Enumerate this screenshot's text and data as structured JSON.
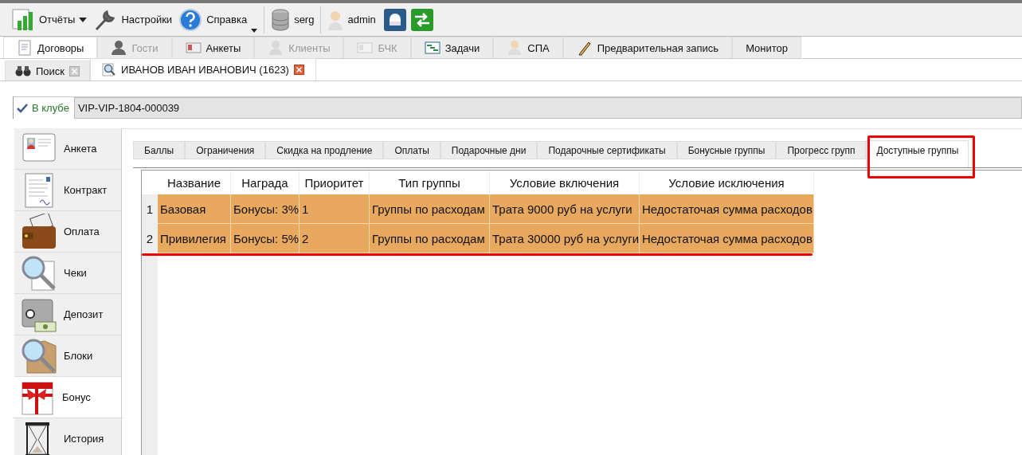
{
  "toolbar": {
    "items": [
      {
        "label": "Отчёты",
        "kind": "dropdown"
      },
      {
        "label": "Настройки",
        "kind": "button"
      },
      {
        "label": "Справка",
        "kind": "menu"
      },
      {
        "label": "serg",
        "kind": "database"
      },
      {
        "label": "admin",
        "kind": "user"
      }
    ]
  },
  "module_tabs": [
    {
      "label": "Договоры",
      "selected": true,
      "disabled": false
    },
    {
      "label": "Гости",
      "selected": false,
      "disabled": true
    },
    {
      "label": "Анкеты",
      "selected": false,
      "disabled": false
    },
    {
      "label": "Клиенты",
      "selected": false,
      "disabled": true
    },
    {
      "label": "БЧК",
      "selected": false,
      "disabled": true
    },
    {
      "label": "Задачи",
      "selected": false,
      "disabled": false
    },
    {
      "label": "СПА",
      "selected": false,
      "disabled": false
    },
    {
      "label": "Предварительная запись",
      "selected": false,
      "disabled": false
    },
    {
      "label": "Монитор",
      "selected": false,
      "disabled": false
    }
  ],
  "doc_tabs": [
    {
      "label": "Поиск",
      "selected": false
    },
    {
      "label": "ИВАНОВ ИВАН ИВАНОВИЧ (1623)",
      "selected": true
    }
  ],
  "club": {
    "label": "В клубе",
    "value": "VIP-VIP-1804-000039"
  },
  "sidebar": {
    "items": [
      {
        "label": "Анкета",
        "selected": false
      },
      {
        "label": "Контракт",
        "selected": false
      },
      {
        "label": "Оплата",
        "selected": false
      },
      {
        "label": "Чеки",
        "selected": false
      },
      {
        "label": "Депозит",
        "selected": false
      },
      {
        "label": "Блоки",
        "selected": false
      },
      {
        "label": "Бонус",
        "selected": true
      },
      {
        "label": "История",
        "selected": false
      }
    ]
  },
  "inner_tabs": [
    {
      "label": "Баллы",
      "selected": false
    },
    {
      "label": "Ограничения",
      "selected": false
    },
    {
      "label": "Скидка на продление",
      "selected": false
    },
    {
      "label": "Оплаты",
      "selected": false
    },
    {
      "label": "Подарочные дни",
      "selected": false
    },
    {
      "label": "Подарочные сертификаты",
      "selected": false
    },
    {
      "label": "Бонусные группы",
      "selected": false
    },
    {
      "label": "Прогресс групп",
      "selected": false
    },
    {
      "label": "Доступные группы",
      "selected": true
    }
  ],
  "table": {
    "columns": [
      "Название",
      "Награда",
      "Приоритет",
      "Тип группы",
      "Условие включения",
      "Условие исключения"
    ],
    "rows": [
      {
        "number": "1",
        "cells": [
          "Базовая",
          "Бонусы: 3%",
          "1",
          "Группы по расходам",
          "Трата 9000 руб на услуги",
          "Недостаточая сумма расходов"
        ]
      },
      {
        "number": "2",
        "cells": [
          "Привилегия",
          "Бонусы: 5%",
          "2",
          "Группы по расходам",
          "Трата 30000 руб на услуги",
          "Недостаточая сумма расходов"
        ]
      }
    ]
  }
}
